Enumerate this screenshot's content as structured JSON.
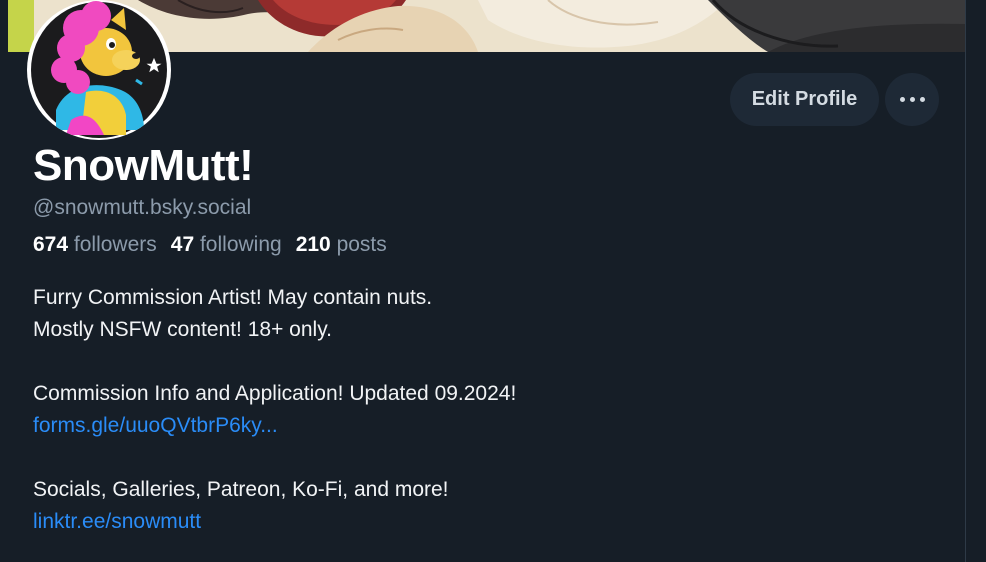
{
  "profile": {
    "display_name": "SnowMutt!",
    "handle": "@snowmutt.bsky.social"
  },
  "actions": {
    "edit_profile_label": "Edit Profile",
    "more_icon": "ellipsis-horizontal-icon"
  },
  "stats": [
    {
      "count": "674",
      "label": "followers"
    },
    {
      "count": "47",
      "label": "following"
    },
    {
      "count": "210",
      "label": "posts"
    }
  ],
  "bio": {
    "line1": "Furry Commission Artist! May contain nuts.",
    "line2": "Mostly NSFW content! 18+ only.",
    "line3": "Commission Info and Application! Updated 09.2024!",
    "link1": "forms.gle/uuoQVtbrP6ky...",
    "line4": "Socials, Galleries, Patreon, Ko-Fi, and more!",
    "link2": "linktr.ee/snowmutt"
  },
  "colors": {
    "background": "#161e27",
    "button_bg": "#1e2936",
    "muted_text": "#8c9bab",
    "link": "#2a8cf7"
  }
}
